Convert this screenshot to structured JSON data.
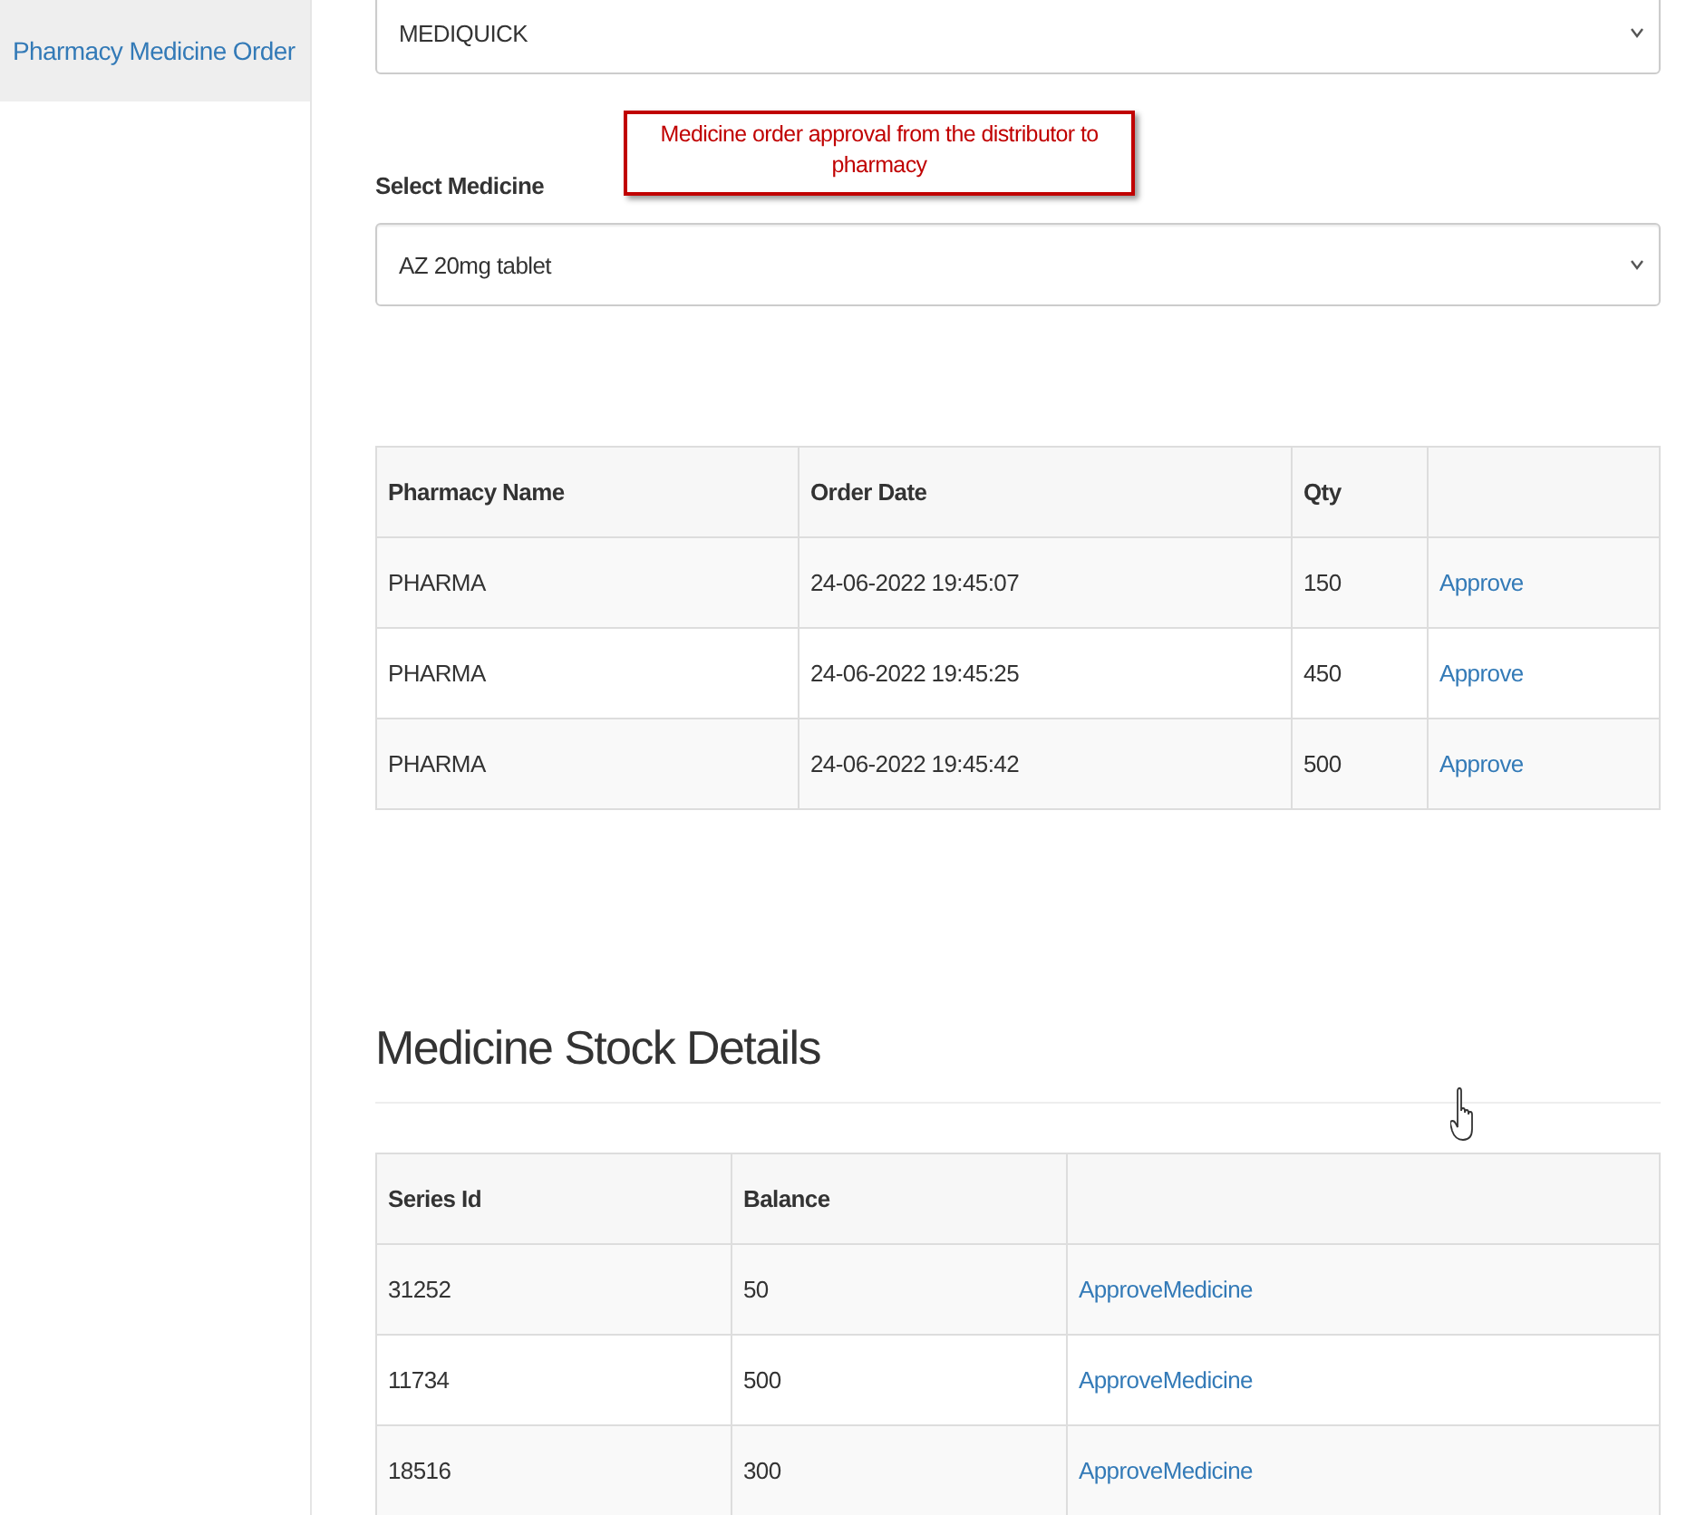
{
  "sidebar": {
    "items": [
      {
        "label": "Pharmacy Medicine Order",
        "selected": true
      }
    ]
  },
  "distributor_select": {
    "value": "MEDIQUICK"
  },
  "annotation": "Medicine order approval from the distributor to pharmacy",
  "medicine_select": {
    "label": "Select Medicine",
    "value": "AZ 20mg tablet"
  },
  "orders_table": {
    "columns": [
      "Pharmacy Name",
      "Order Date",
      "Qty"
    ],
    "rows": [
      {
        "pharmacy": "PHARMA",
        "date": "24-06-2022 19:45:07",
        "qty": "150",
        "action": "Approve"
      },
      {
        "pharmacy": "PHARMA",
        "date": "24-06-2022 19:45:25",
        "qty": "450",
        "action": "Approve"
      },
      {
        "pharmacy": "PHARMA",
        "date": "24-06-2022 19:45:42",
        "qty": "500",
        "action": "Approve"
      }
    ]
  },
  "stock": {
    "heading": "Medicine Stock Details",
    "columns": [
      "Series Id",
      "Balance"
    ],
    "rows": [
      {
        "series_id": "31252",
        "balance": "50",
        "action": "ApproveMedicine"
      },
      {
        "series_id": "11734",
        "balance": "500",
        "action": "ApproveMedicine"
      },
      {
        "series_id": "18516",
        "balance": "300",
        "action": "ApproveMedicine"
      }
    ]
  }
}
